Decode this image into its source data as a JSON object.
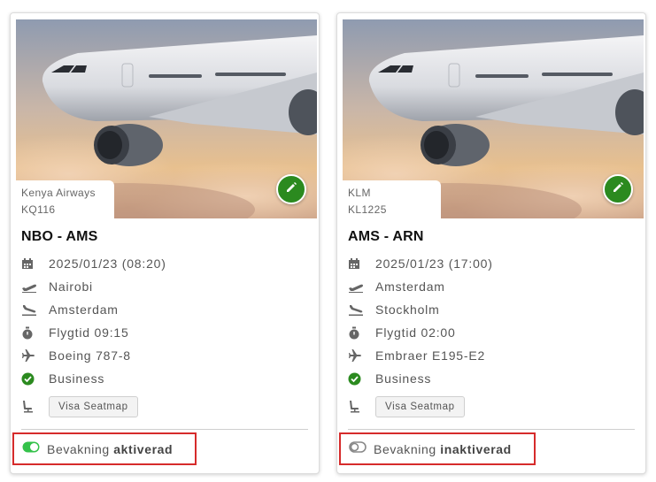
{
  "colors": {
    "accent_green": "#2b8a1f",
    "highlight_red": "#d62b2b",
    "toggle_on": "#34c24a",
    "toggle_off": "#888888"
  },
  "cards": [
    {
      "airline": "Kenya Airways",
      "flight_number": "KQ116",
      "route": "NBO - AMS",
      "datetime": "2025/01/23 (08:20)",
      "departure_city": "Nairobi",
      "arrival_city": "Amsterdam",
      "flight_time": "Flygtid 09:15",
      "aircraft": "Boeing 787-8",
      "cabin_class": "Business",
      "seatmap_label": "Visa Seatmap",
      "bevakning_label": "Bevakning",
      "bevakning_status": "aktiverad",
      "bevakning_enabled": true,
      "icons": [
        "calendar-icon",
        "takeoff-icon",
        "landing-icon",
        "stopwatch-icon",
        "airplane-icon",
        "check-circle-icon",
        "seat-icon",
        "pencil-icon",
        "toggle-on-icon"
      ]
    },
    {
      "airline": "KLM",
      "flight_number": "KL1225",
      "route": "AMS - ARN",
      "datetime": "2025/01/23 (17:00)",
      "departure_city": "Amsterdam",
      "arrival_city": "Stockholm",
      "flight_time": "Flygtid 02:00",
      "aircraft": "Embraer E195-E2",
      "cabin_class": "Business",
      "seatmap_label": "Visa Seatmap",
      "bevakning_label": "Bevakning",
      "bevakning_status": "inaktiverad",
      "bevakning_enabled": false,
      "icons": [
        "calendar-icon",
        "takeoff-icon",
        "landing-icon",
        "stopwatch-icon",
        "airplane-icon",
        "check-circle-icon",
        "seat-icon",
        "pencil-icon",
        "toggle-off-icon"
      ]
    }
  ]
}
